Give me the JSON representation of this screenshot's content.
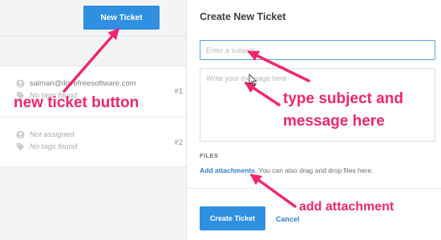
{
  "left": {
    "new_ticket_label": "New Ticket",
    "tickets": [
      {
        "email": "salman@ilovefreesoftware.com",
        "tags": "No tags found",
        "number": "#1"
      },
      {
        "assignee": "Not assigned",
        "tags": "No tags found",
        "number": "#2"
      }
    ]
  },
  "panel": {
    "title": "Create New Ticket",
    "subject_placeholder": "Enter a subject",
    "message_placeholder": "Write your message here",
    "files_label": "FILES",
    "attach_link": "Add attachments",
    "attach_hint": ". You can also drag and drop files here.",
    "create_label": "Create Ticket",
    "cancel_label": "Cancel"
  },
  "annotations": {
    "new_ticket": "new ticket button",
    "type_line1": "type subject and",
    "type_line2": "message here",
    "attach": "add attachment"
  },
  "colors": {
    "accent": "#2f8fe0",
    "annotation": "#f2256e"
  },
  "icons": [
    "user-icon",
    "tag-icon",
    "mouse-cursor-icon"
  ]
}
